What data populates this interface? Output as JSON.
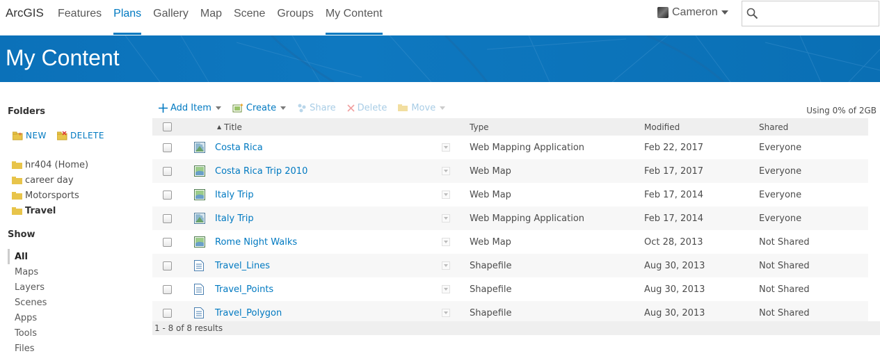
{
  "nav": {
    "brand": "ArcGIS",
    "links": [
      "Features",
      "Plans",
      "Gallery",
      "Map",
      "Scene",
      "Groups",
      "My Content"
    ],
    "user": "Cameron",
    "search_placeholder": "",
    "accent": "#0079c1"
  },
  "banner": {
    "title": "My Content"
  },
  "sidebar": {
    "folders_heading": "Folders",
    "new_label": "NEW",
    "delete_label": "DELETE",
    "folders": [
      "hr404 (Home)",
      "career day",
      "Motorsports",
      "Travel"
    ],
    "show_heading": "Show",
    "show_items": [
      "All",
      "Maps",
      "Layers",
      "Scenes",
      "Apps",
      "Tools",
      "Files"
    ]
  },
  "toolbar": {
    "add_item": "Add Item",
    "create": "Create",
    "share": "Share",
    "delete": "Delete",
    "move": "Move",
    "usage": "Using 0% of 2GB"
  },
  "table": {
    "headers": {
      "title": "Title",
      "type": "Type",
      "modified": "Modified",
      "shared": "Shared"
    },
    "rows": [
      {
        "title": "Costa Rica",
        "type": "Web Mapping Application",
        "modified": "Feb 22, 2017",
        "shared": "Everyone",
        "icon": "web-app-icon"
      },
      {
        "title": "Costa Rica Trip 2010",
        "type": "Web Map",
        "modified": "Feb 17, 2017",
        "shared": "Everyone",
        "icon": "web-map-icon"
      },
      {
        "title": "Italy Trip",
        "type": "Web Map",
        "modified": "Feb 17, 2014",
        "shared": "Everyone",
        "icon": "web-map-icon"
      },
      {
        "title": "Italy Trip",
        "type": "Web Mapping Application",
        "modified": "Feb 17, 2014",
        "shared": "Everyone",
        "icon": "web-app-icon"
      },
      {
        "title": "Rome Night Walks",
        "type": "Web Map",
        "modified": "Oct 28, 2013",
        "shared": "Not Shared",
        "icon": "web-map-icon"
      },
      {
        "title": "Travel_Lines",
        "type": "Shapefile",
        "modified": "Aug 30, 2013",
        "shared": "Not Shared",
        "icon": "shapefile-icon"
      },
      {
        "title": "Travel_Points",
        "type": "Shapefile",
        "modified": "Aug 30, 2013",
        "shared": "Not Shared",
        "icon": "shapefile-icon"
      },
      {
        "title": "Travel_Polygon",
        "type": "Shapefile",
        "modified": "Aug 30, 2013",
        "shared": "Not Shared",
        "icon": "shapefile-icon"
      }
    ],
    "footer": "1 - 8 of 8 results"
  }
}
